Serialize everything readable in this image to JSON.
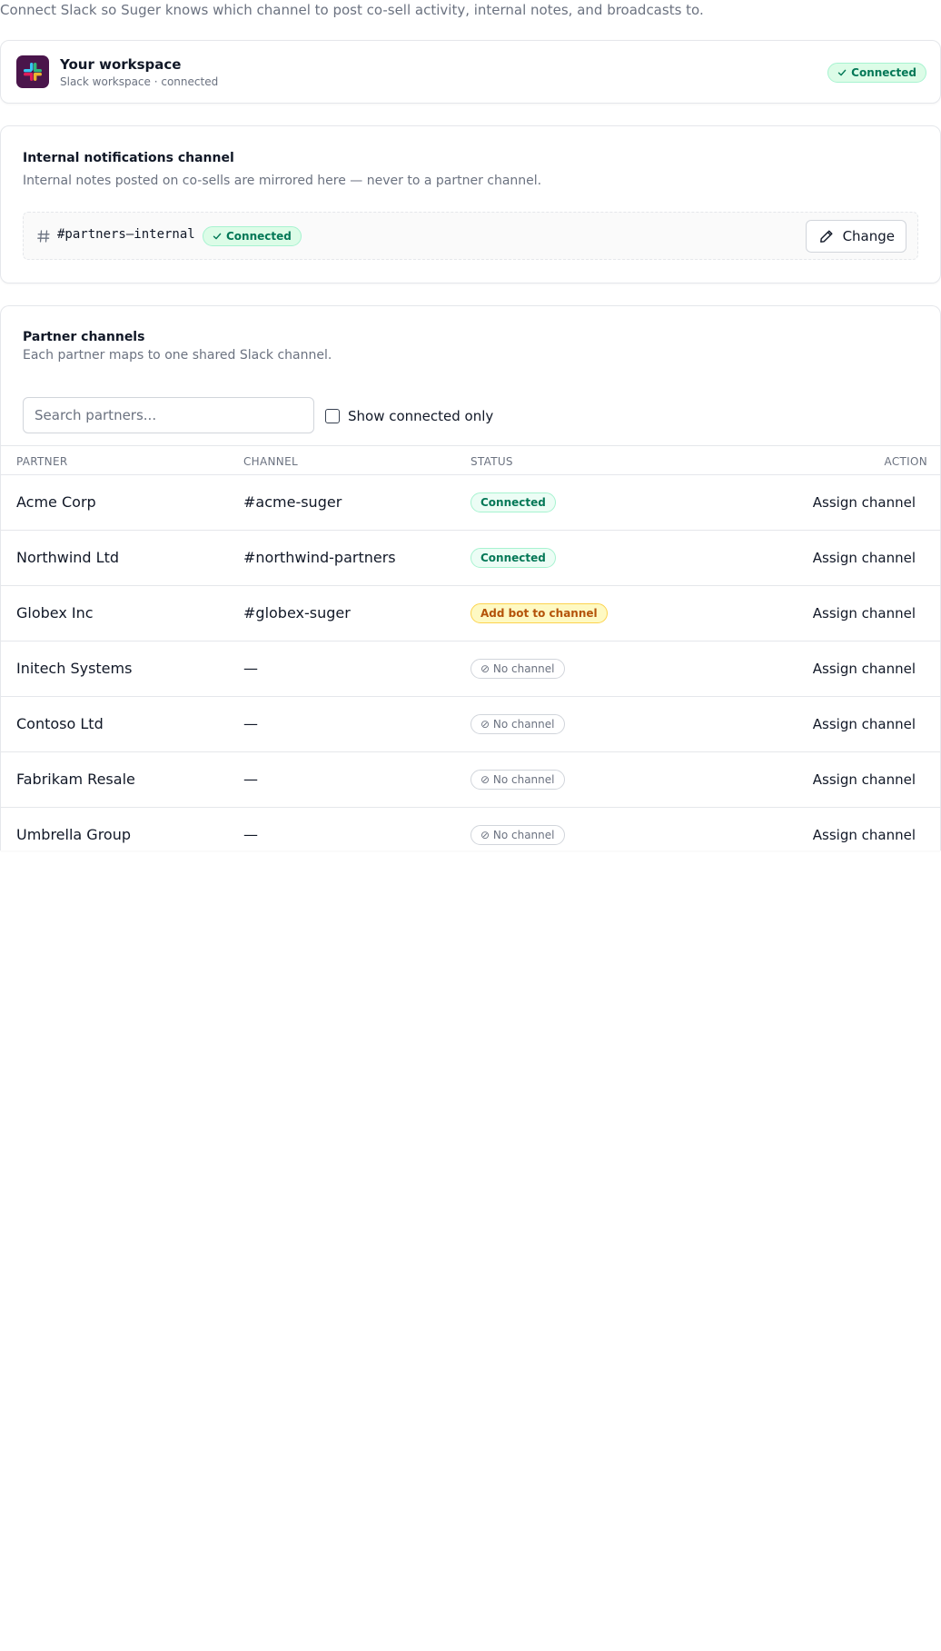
{
  "intro": "Connect Slack so Suger knows which channel to post co-sell activity, internal notes, and broadcasts to.",
  "workspace": {
    "title": "Your workspace",
    "subtitle": "Slack workspace · connected",
    "status": "Connected"
  },
  "internal": {
    "title": "Internal notifications channel",
    "description": "Internal notes posted on co-sells are mirrored here — never to a partner channel.",
    "channel": "#partners–internal",
    "status": "Connected",
    "change_label": "Change"
  },
  "partners": {
    "title": "Partner channels",
    "description": "Each partner maps to one shared Slack channel.",
    "search_placeholder": "Search partners...",
    "filter_label": "Show connected only",
    "columns": {
      "partner": "PARTNER",
      "channel": "CHANNEL",
      "status": "STATUS",
      "action": "ACTION"
    },
    "rows": [
      {
        "partner": "Acme Corp",
        "channel": "#acme-suger",
        "status": "Connected",
        "status_type": "connected",
        "action": "Assign channel"
      },
      {
        "partner": "Northwind Ltd",
        "channel": "#northwind-partners",
        "status": "Connected",
        "status_type": "connected",
        "action": "Assign channel"
      },
      {
        "partner": "Globex Inc",
        "channel": "#globex-suger",
        "status": "Add bot to channel",
        "status_type": "warning",
        "action": "Assign channel"
      },
      {
        "partner": "Initech Systems",
        "channel": "—",
        "status": "⊘ No channel",
        "status_type": "none",
        "action": "Assign channel"
      },
      {
        "partner": "Contoso Ltd",
        "channel": "—",
        "status": "⊘ No channel",
        "status_type": "none",
        "action": "Assign channel"
      },
      {
        "partner": "Fabrikam Resale",
        "channel": "—",
        "status": "⊘ No channel",
        "status_type": "none",
        "action": "Assign channel"
      },
      {
        "partner": "Umbrella Group",
        "channel": "—",
        "status": "⊘ No channel",
        "status_type": "none",
        "action": "Assign channel"
      }
    ]
  },
  "colors": {
    "connected_bg": "#dcfce7",
    "connected_text": "#047857",
    "warning_bg": "#fef9c3",
    "warning_text": "#b45309",
    "slack_brand": "#4a154b"
  }
}
